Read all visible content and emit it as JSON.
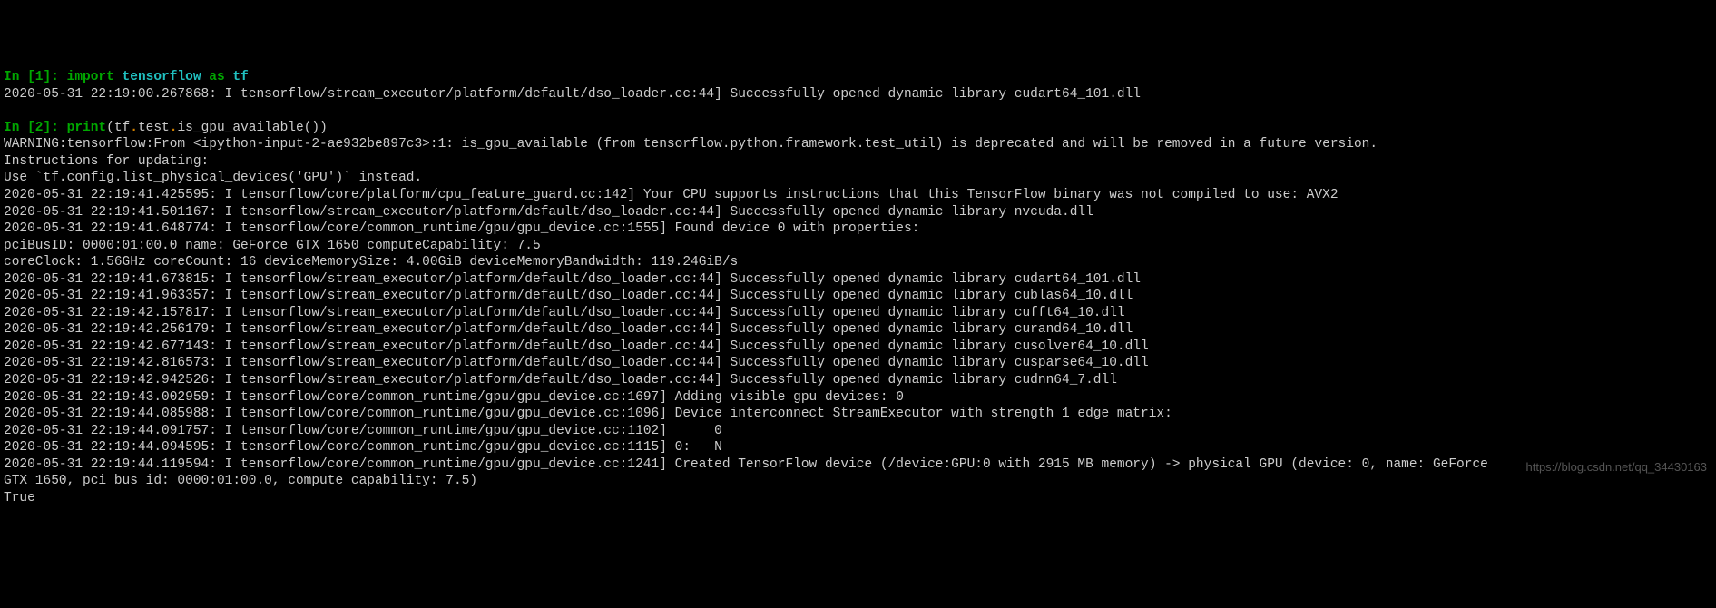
{
  "lines": [
    {
      "segments": [
        {
          "cls": "prompt-in",
          "text": "In [1]: "
        },
        {
          "cls": "kw-green",
          "text": "import "
        },
        {
          "cls": "kw-cyan",
          "text": "tensorflow "
        },
        {
          "cls": "kw-green",
          "text": "as "
        },
        {
          "cls": "kw-cyan",
          "text": "tf"
        }
      ]
    },
    {
      "segments": [
        {
          "cls": "",
          "text": "2020-05-31 22:19:00.267868: I tensorflow/stream_executor/platform/default/dso_loader.cc:44] Successfully opened dynamic library cudart64_101.dll"
        }
      ]
    },
    {
      "segments": [
        {
          "cls": "",
          "text": ""
        }
      ]
    },
    {
      "segments": [
        {
          "cls": "prompt-in",
          "text": "In [2]: "
        },
        {
          "cls": "kw-green",
          "text": "print"
        },
        {
          "cls": "",
          "text": "(tf"
        },
        {
          "cls": "kw-orange",
          "text": "."
        },
        {
          "cls": "",
          "text": "test"
        },
        {
          "cls": "kw-orange",
          "text": "."
        },
        {
          "cls": "",
          "text": "is_gpu_available())"
        }
      ]
    },
    {
      "segments": [
        {
          "cls": "",
          "text": "WARNING:tensorflow:From <ipython-input-2-ae932be897c3>:1: is_gpu_available (from tensorflow.python.framework.test_util) is deprecated and will be removed in a future version."
        }
      ]
    },
    {
      "segments": [
        {
          "cls": "",
          "text": "Instructions for updating:"
        }
      ]
    },
    {
      "segments": [
        {
          "cls": "",
          "text": "Use `tf.config.list_physical_devices('GPU')` instead."
        }
      ]
    },
    {
      "segments": [
        {
          "cls": "",
          "text": "2020-05-31 22:19:41.425595: I tensorflow/core/platform/cpu_feature_guard.cc:142] Your CPU supports instructions that this TensorFlow binary was not compiled to use: AVX2"
        }
      ]
    },
    {
      "segments": [
        {
          "cls": "",
          "text": "2020-05-31 22:19:41.501167: I tensorflow/stream_executor/platform/default/dso_loader.cc:44] Successfully opened dynamic library nvcuda.dll"
        }
      ]
    },
    {
      "segments": [
        {
          "cls": "",
          "text": "2020-05-31 22:19:41.648774: I tensorflow/core/common_runtime/gpu/gpu_device.cc:1555] Found device 0 with properties:"
        }
      ]
    },
    {
      "segments": [
        {
          "cls": "",
          "text": "pciBusID: 0000:01:00.0 name: GeForce GTX 1650 computeCapability: 7.5"
        }
      ]
    },
    {
      "segments": [
        {
          "cls": "",
          "text": "coreClock: 1.56GHz coreCount: 16 deviceMemorySize: 4.00GiB deviceMemoryBandwidth: 119.24GiB/s"
        }
      ]
    },
    {
      "segments": [
        {
          "cls": "",
          "text": "2020-05-31 22:19:41.673815: I tensorflow/stream_executor/platform/default/dso_loader.cc:44] Successfully opened dynamic library cudart64_101.dll"
        }
      ]
    },
    {
      "segments": [
        {
          "cls": "",
          "text": "2020-05-31 22:19:41.963357: I tensorflow/stream_executor/platform/default/dso_loader.cc:44] Successfully opened dynamic library cublas64_10.dll"
        }
      ]
    },
    {
      "segments": [
        {
          "cls": "",
          "text": "2020-05-31 22:19:42.157817: I tensorflow/stream_executor/platform/default/dso_loader.cc:44] Successfully opened dynamic library cufft64_10.dll"
        }
      ]
    },
    {
      "segments": [
        {
          "cls": "",
          "text": "2020-05-31 22:19:42.256179: I tensorflow/stream_executor/platform/default/dso_loader.cc:44] Successfully opened dynamic library curand64_10.dll"
        }
      ]
    },
    {
      "segments": [
        {
          "cls": "",
          "text": "2020-05-31 22:19:42.677143: I tensorflow/stream_executor/platform/default/dso_loader.cc:44] Successfully opened dynamic library cusolver64_10.dll"
        }
      ]
    },
    {
      "segments": [
        {
          "cls": "",
          "text": "2020-05-31 22:19:42.816573: I tensorflow/stream_executor/platform/default/dso_loader.cc:44] Successfully opened dynamic library cusparse64_10.dll"
        }
      ]
    },
    {
      "segments": [
        {
          "cls": "",
          "text": "2020-05-31 22:19:42.942526: I tensorflow/stream_executor/platform/default/dso_loader.cc:44] Successfully opened dynamic library cudnn64_7.dll"
        }
      ]
    },
    {
      "segments": [
        {
          "cls": "",
          "text": "2020-05-31 22:19:43.002959: I tensorflow/core/common_runtime/gpu/gpu_device.cc:1697] Adding visible gpu devices: 0"
        }
      ]
    },
    {
      "segments": [
        {
          "cls": "",
          "text": "2020-05-31 22:19:44.085988: I tensorflow/core/common_runtime/gpu/gpu_device.cc:1096] Device interconnect StreamExecutor with strength 1 edge matrix:"
        }
      ]
    },
    {
      "segments": [
        {
          "cls": "",
          "text": "2020-05-31 22:19:44.091757: I tensorflow/core/common_runtime/gpu/gpu_device.cc:1102]      0"
        }
      ]
    },
    {
      "segments": [
        {
          "cls": "",
          "text": "2020-05-31 22:19:44.094595: I tensorflow/core/common_runtime/gpu/gpu_device.cc:1115] 0:   N"
        }
      ]
    },
    {
      "segments": [
        {
          "cls": "",
          "text": "2020-05-31 22:19:44.119594: I tensorflow/core/common_runtime/gpu/gpu_device.cc:1241] Created TensorFlow device (/device:GPU:0 with 2915 MB memory) -> physical GPU (device: 0, name: GeForce"
        }
      ]
    },
    {
      "segments": [
        {
          "cls": "",
          "text": "GTX 1650, pci bus id: 0000:01:00.0, compute capability: 7.5)"
        }
      ]
    },
    {
      "segments": [
        {
          "cls": "",
          "text": "True"
        }
      ]
    }
  ],
  "watermark": "https://blog.csdn.net/qq_34430163"
}
